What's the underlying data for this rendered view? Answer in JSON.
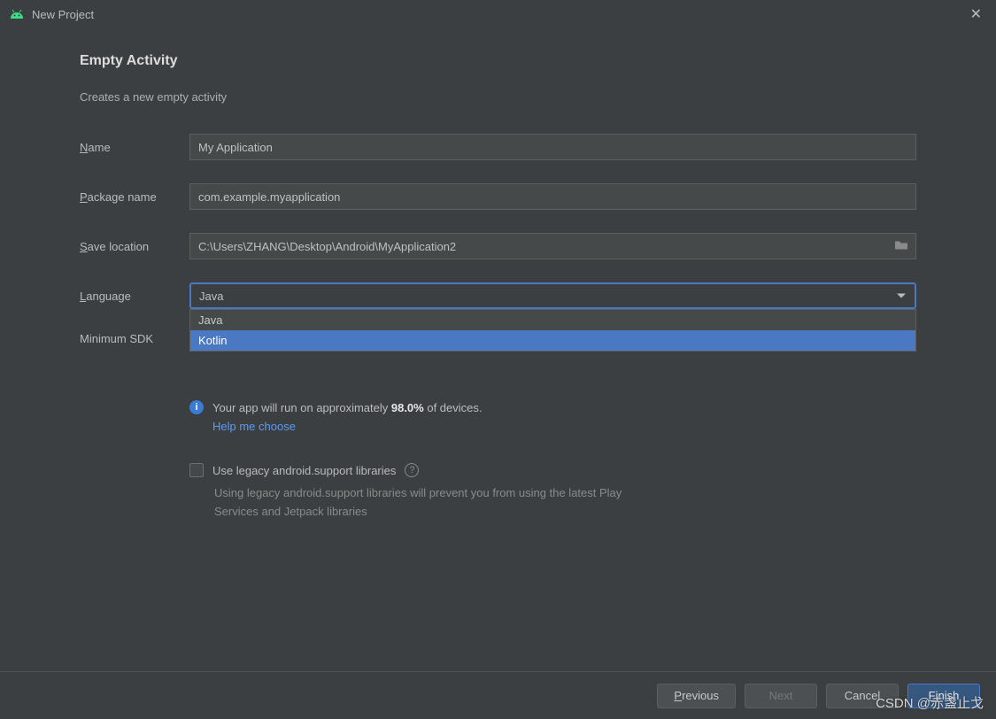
{
  "titlebar": {
    "title": "New Project"
  },
  "heading": "Empty Activity",
  "description": "Creates a new empty activity",
  "fields": {
    "name": {
      "label": "Name",
      "value": "My Application"
    },
    "package": {
      "label": "Package name",
      "value": "com.example.myapplication"
    },
    "save": {
      "label": "Save location",
      "value": "C:\\Users\\ZHANG\\Desktop\\Android\\MyApplication2"
    },
    "language": {
      "label": "Language",
      "value": "Java",
      "options": [
        "Java",
        "Kotlin"
      ],
      "highlighted": "Kotlin"
    },
    "minsdk": {
      "label": "Minimum SDK"
    }
  },
  "info": {
    "prefix": "Your app will run on approximately ",
    "percent": "98.0%",
    "suffix": " of devices.",
    "help_link": "Help me choose"
  },
  "legacy": {
    "label": "Use legacy android.support libraries",
    "desc": "Using legacy android.support libraries will prevent you from using the latest Play Services and Jetpack libraries"
  },
  "buttons": {
    "previous": "Previous",
    "next": "Next",
    "cancel": "Cancel",
    "finish": "Finish"
  },
  "watermark": "CSDN @赤盏止戈"
}
